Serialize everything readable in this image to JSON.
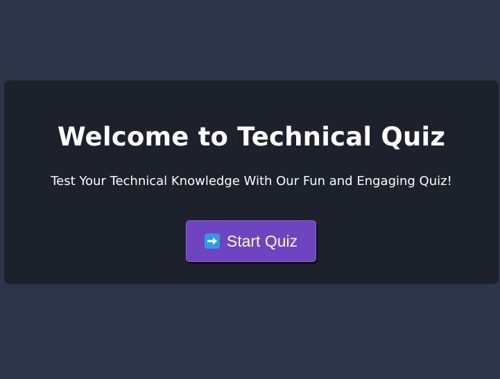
{
  "card": {
    "title": "Welcome to Technical Quiz",
    "subtitle": "Test Your Technical Knowledge With Our Fun and Engaging Quiz!",
    "start_button": {
      "label": "Start Quiz",
      "icon": "right-arrow-emoji-icon"
    }
  },
  "colors": {
    "page_background": "#2d3648",
    "card_background": "#1d212c",
    "button_background": "#6f44c0",
    "icon_background": "#2f9be8",
    "text": "#ffffff"
  }
}
